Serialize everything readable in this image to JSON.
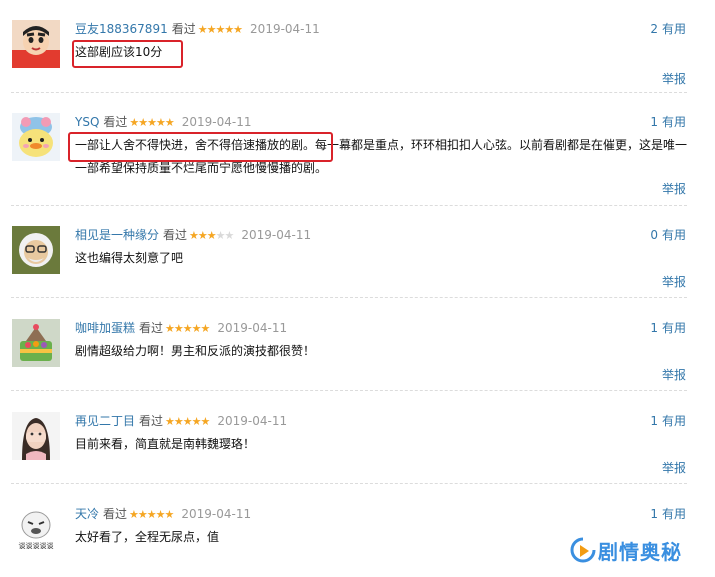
{
  "comments": [
    {
      "user": "豆友188367891",
      "status": "看过",
      "stars": "★★★★★",
      "stars_off": "",
      "date": "2019-04-11",
      "votes": "2",
      "useful_label": "有用",
      "text": "这部剧应该10分",
      "report": "举报",
      "avatar_icon": "crayon-shinchan-avatar-icon"
    },
    {
      "user": "YSQ",
      "status": "看过",
      "stars": "★★★★★",
      "stars_off": "",
      "date": "2019-04-11",
      "votes": "1",
      "useful_label": "有用",
      "text": "一部让人舍不得快进，舍不得倍速播放的剧。每一幕都是重点，环环相扣扣人心弦。以前看剧都是在催更，这是唯一一部希望保持质量不烂尾而宁愿他慢慢播的剧。",
      "report": "举报",
      "avatar_icon": "plush-duck-avatar-icon"
    },
    {
      "user": "相见是一种缘分",
      "status": "看过",
      "stars": "★★★",
      "stars_off": "★★",
      "date": "2019-04-11",
      "votes": "0",
      "useful_label": "有用",
      "text": "这也编得太刻意了吧",
      "report": "举报",
      "avatar_icon": "miyazaki-cartoon-avatar-icon"
    },
    {
      "user": "咖啡加蛋糕",
      "status": "看过",
      "stars": "★★★★★",
      "stars_off": "",
      "date": "2019-04-11",
      "votes": "1",
      "useful_label": "有用",
      "text": "剧情超级给力啊！男主和反派的演技都很赞！",
      "report": "举报",
      "avatar_icon": "cake-avatar-icon"
    },
    {
      "user": "再见二丁目",
      "status": "看过",
      "stars": "★★★★★",
      "stars_off": "",
      "date": "2019-04-11",
      "votes": "1",
      "useful_label": "有用",
      "text": "目前来看，简直就是南韩魏璎珞！",
      "report": "举报",
      "avatar_icon": "girl-photo-avatar-icon"
    },
    {
      "user": "天冷",
      "status": "看过",
      "stars": "★★★★★",
      "stars_off": "",
      "date": "2019-04-11",
      "votes": "1",
      "useful_label": "有用",
      "text": "太好看了，全程无尿点，值",
      "report": "",
      "avatar_icon": "meme-face-avatar-icon",
      "avatar_caption": "谈谈谈谈谈"
    }
  ],
  "watermark": {
    "text": "剧情奥秘",
    "icon": "play-logo-icon"
  },
  "colors": {
    "link": "#3377aa",
    "star": "#f5a623",
    "highlight": "#d9232a",
    "watermark": "#3a8fe0"
  }
}
